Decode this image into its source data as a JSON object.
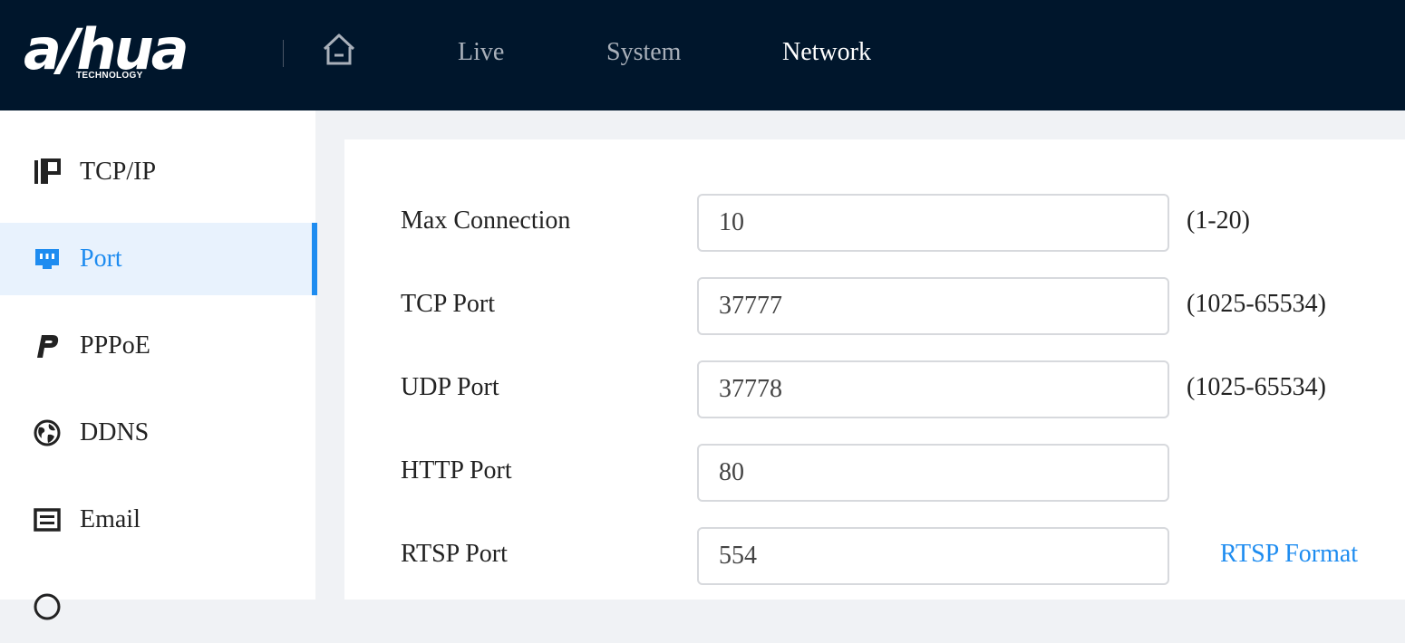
{
  "brand": {
    "logo_text": "a/hua",
    "logo_subtext": "TECHNOLOGY"
  },
  "nav": {
    "home_icon": "home-icon",
    "items": [
      {
        "label": "Live"
      },
      {
        "label": "System"
      },
      {
        "label": "Network",
        "active": true
      }
    ]
  },
  "sidebar": {
    "items": [
      {
        "label": "TCP/IP",
        "icon": "ip-icon"
      },
      {
        "label": "Port",
        "icon": "port-icon",
        "active": true
      },
      {
        "label": "PPPoE",
        "icon": "pppoe-icon"
      },
      {
        "label": "DDNS",
        "icon": "globe-icon"
      },
      {
        "label": "Email",
        "icon": "email-icon"
      }
    ]
  },
  "form": {
    "max_connection": {
      "label": "Max Connection",
      "value": "10",
      "hint": "(1-20)"
    },
    "tcp_port": {
      "label": "TCP Port",
      "value": "37777",
      "hint": "(1025-65534)"
    },
    "udp_port": {
      "label": "UDP Port",
      "value": "37778",
      "hint": "(1025-65534)"
    },
    "http_port": {
      "label": "HTTP Port",
      "value": "80"
    },
    "rtsp_port": {
      "label": "RTSP Port",
      "value": "554",
      "link": "RTSP Format"
    }
  },
  "colors": {
    "topbar_bg": "#00162c",
    "accent": "#1e8cf0",
    "active_bg": "#e8f2fd",
    "page_bg": "#f0f2f5"
  }
}
